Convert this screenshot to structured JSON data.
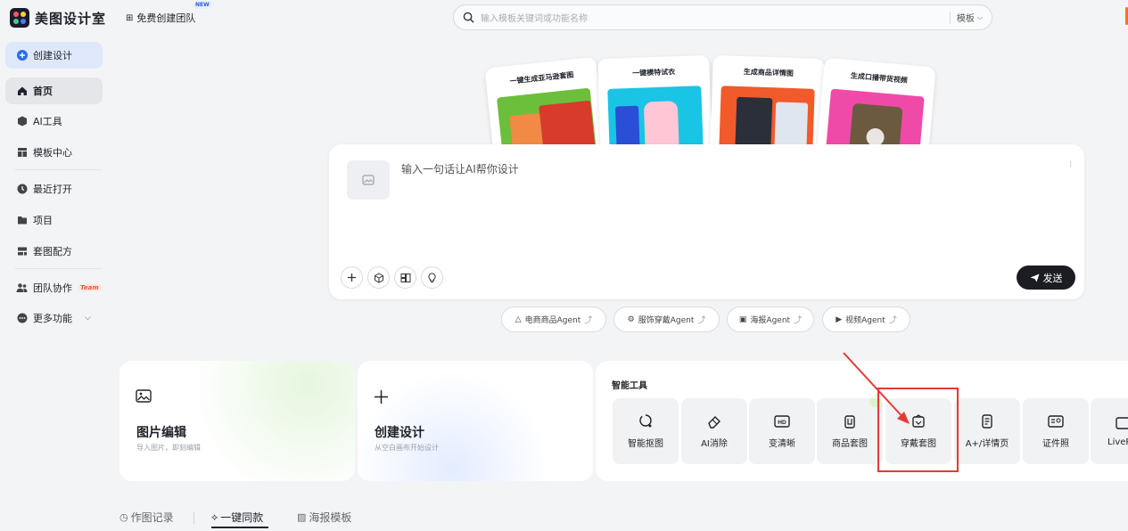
{
  "app": {
    "name": "美图设计室",
    "team_link": "免费创建团队",
    "new_badge": "NEW"
  },
  "search": {
    "placeholder": "输入模板关键词或功能名称",
    "scope": "模板"
  },
  "sidebar": {
    "create": "创建设计",
    "items": [
      {
        "label": "首页",
        "icon": "home-icon"
      },
      {
        "label": "AI工具",
        "icon": "ai-tools-icon"
      },
      {
        "label": "模板中心",
        "icon": "template-icon"
      },
      {
        "label": "最近打开",
        "icon": "clock-icon"
      },
      {
        "label": "项目",
        "icon": "folder-icon"
      },
      {
        "label": "套图配方",
        "icon": "recipe-icon"
      },
      {
        "label": "团队协作",
        "icon": "team-icon",
        "badge": "Team"
      },
      {
        "label": "更多功能",
        "icon": "more-icon"
      }
    ]
  },
  "hero_cards": [
    {
      "title": "一键生成亚马逊套图"
    },
    {
      "title": "一键模特试衣"
    },
    {
      "title": "生成商品详情图"
    },
    {
      "title": "生成口播带货视频"
    }
  ],
  "prompt": {
    "placeholder": "输入一句话让AI帮你设计",
    "send_label": "发送"
  },
  "agents": [
    "电商商品Agent",
    "服饰穿戴Agent",
    "海报Agent",
    "视频Agent"
  ],
  "quick_cards": [
    {
      "title": "图片编辑",
      "subtitle": "导入图片，即刻编辑"
    },
    {
      "title": "创建设计",
      "subtitle": "从空白画布开始设计"
    }
  ],
  "smart_tools": {
    "title": "智能工具",
    "items": [
      "智能抠图",
      "AI消除",
      "变清晰",
      "商品套图",
      "穿戴套图",
      "A+/详情页",
      "证件照",
      "LiveP"
    ]
  },
  "bottom_tabs": [
    "作图记录",
    "一键同款",
    "海报模板"
  ],
  "colors": {
    "accent": "#2b6cf0",
    "highlight": "#e53935",
    "send_bg": "#1c1d22"
  }
}
